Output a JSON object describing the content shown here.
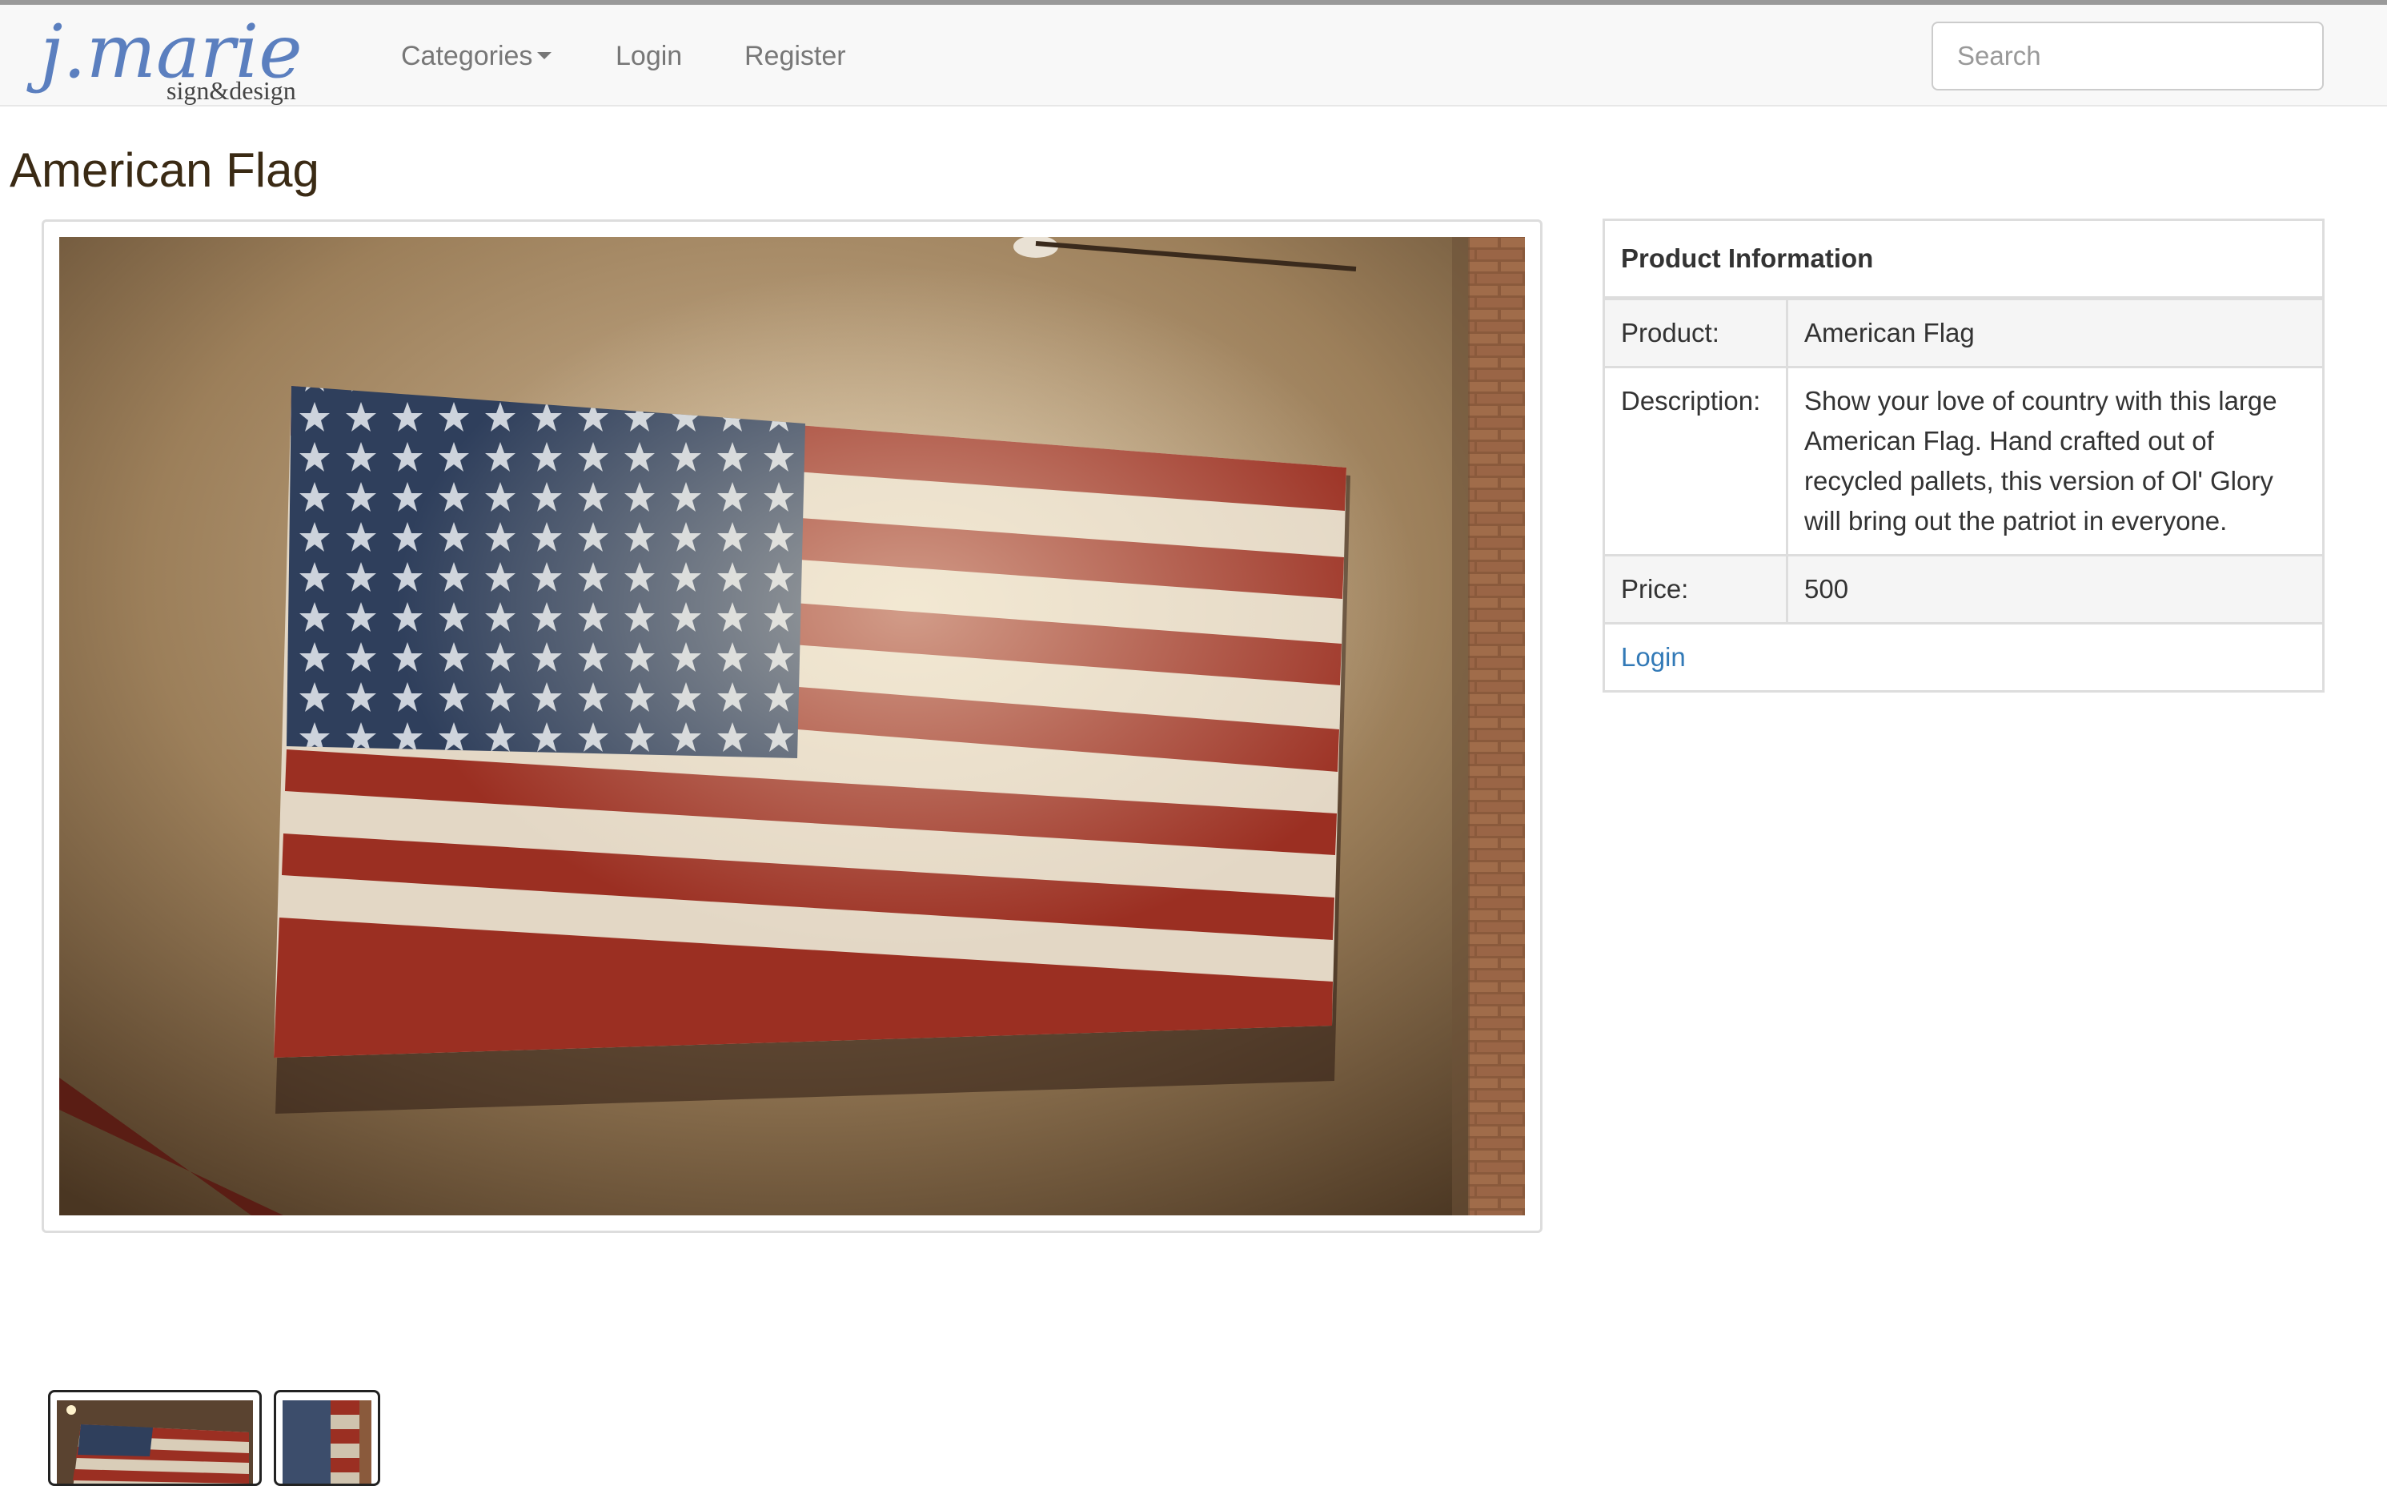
{
  "brand": {
    "logo_script": "j.marie",
    "logo_tagline": "sign&design",
    "logo_color": "#5b7fbf"
  },
  "nav": {
    "categories_label": "Categories",
    "login_label": "Login",
    "register_label": "Register"
  },
  "search": {
    "placeholder": "Search",
    "value": ""
  },
  "product": {
    "title": "American Flag",
    "table_header": "Product Information",
    "rows": [
      {
        "label": "Product:",
        "value": "American Flag"
      },
      {
        "label": "Description:",
        "value": "Show your love of country with this large American Flag. Hand crafted out of recycled pallets, this version of Ol' Glory will bring out the patriot in everyone."
      },
      {
        "label": "Price:",
        "value": "500"
      }
    ],
    "login_link": "Login"
  },
  "images": {
    "main": "wooden-american-flag-photo",
    "thumbnails": [
      "flag-thumbnail-1",
      "flag-thumbnail-2"
    ]
  },
  "colors": {
    "title_color": "#3a2a14",
    "link_color": "#337ab7",
    "flag_red": "#9b2f22",
    "flag_blue": "#2f3f5c",
    "flag_white": "#e6ddd0"
  }
}
